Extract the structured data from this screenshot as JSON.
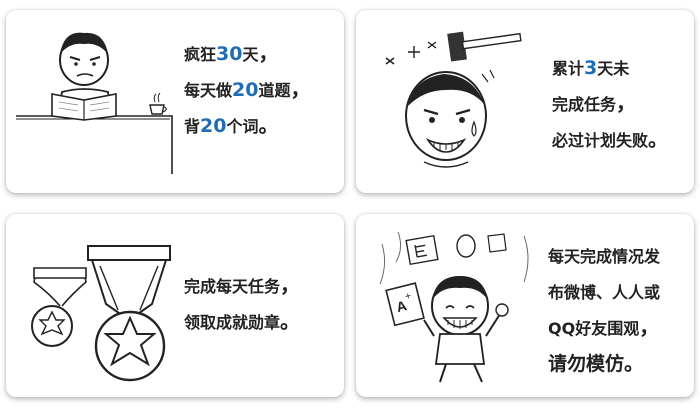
{
  "panels": [
    {
      "art": "student-reading-icon",
      "lines": [
        {
          "a": "疯狂",
          "n": "30",
          "b": "天",
          "tail": "，"
        },
        {
          "a": "每天做",
          "n": "20",
          "b": "道题",
          "tail": "，"
        },
        {
          "a": "背",
          "n": "20",
          "b": "个词",
          "tail": "。"
        }
      ]
    },
    {
      "art": "hammer-penalty-icon",
      "lines": [
        {
          "a": "累计",
          "n": "3",
          "b": "天未",
          "tail": ""
        },
        {
          "a": "完成任务",
          "n": "",
          "b": "",
          "tail": "，"
        },
        {
          "a": "必过计划失败",
          "n": "",
          "b": "",
          "tail": "。"
        }
      ]
    },
    {
      "art": "medals-icon",
      "lines": [
        {
          "a": "完成每天任务",
          "n": "",
          "b": "",
          "tail": "，"
        },
        {
          "a": "领取成就勋章",
          "n": "",
          "b": "",
          "tail": "。"
        }
      ]
    },
    {
      "art": "celebrating-student-icon",
      "lines": [
        {
          "a": "每天完成情况发",
          "n": "",
          "b": "",
          "tail": ""
        },
        {
          "a": "布微博、人人或",
          "n": "",
          "b": "",
          "tail": ""
        },
        {
          "a": "QQ好友围观",
          "n": "",
          "b": "",
          "tail": "，"
        },
        {
          "a": "请勿模仿",
          "n": "",
          "b": "",
          "tail": "。"
        }
      ]
    }
  ]
}
